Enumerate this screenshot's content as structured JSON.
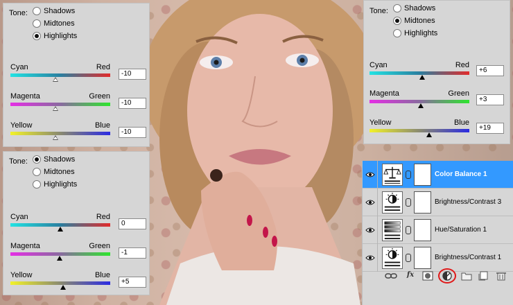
{
  "tone_options": [
    "Shadows",
    "Midtones",
    "Highlights"
  ],
  "panels": {
    "highlights": {
      "tone_label": "Tone:",
      "selected": "Highlights",
      "sliders": [
        {
          "left": "Cyan",
          "right": "Red",
          "value": "-10",
          "level": -10
        },
        {
          "left": "Magenta",
          "right": "Green",
          "value": "-10",
          "level": -10
        },
        {
          "left": "Yellow",
          "right": "Blue",
          "value": "-10",
          "level": -10
        }
      ]
    },
    "shadows": {
      "tone_label": "Tone:",
      "selected": "Shadows",
      "sliders": [
        {
          "left": "Cyan",
          "right": "Red",
          "value": "0",
          "level": 0
        },
        {
          "left": "Magenta",
          "right": "Green",
          "value": "-1",
          "level": -1
        },
        {
          "left": "Yellow",
          "right": "Blue",
          "value": "+5",
          "level": 5
        }
      ]
    },
    "midtones": {
      "tone_label": "Tone:",
      "selected": "Midtones",
      "sliders": [
        {
          "left": "Cyan",
          "right": "Red",
          "value": "+6",
          "level": 6
        },
        {
          "left": "Magenta",
          "right": "Green",
          "value": "+3",
          "level": 3
        },
        {
          "left": "Yellow",
          "right": "Blue",
          "value": "+19",
          "level": 19
        }
      ]
    }
  },
  "layers": [
    {
      "name": "Color Balance 1",
      "icon": "balance-scale-icon",
      "selected": true
    },
    {
      "name": "Brightness/Contrast 3",
      "icon": "sun-contrast-icon",
      "selected": false
    },
    {
      "name": "Hue/Saturation 1",
      "icon": "hue-saturation-icon",
      "selected": false
    },
    {
      "name": "Brightness/Contrast 1",
      "icon": "sun-contrast-icon",
      "selected": false
    }
  ],
  "layer_footer": {
    "fx_label": "fx",
    "tools": [
      "link-icon",
      "fx-icon",
      "mask-icon",
      "adjustment-layer-icon",
      "folder-icon",
      "new-layer-icon",
      "trash-icon"
    ]
  },
  "colors": {
    "selected_layer": "#3399ff",
    "panel_bg": "#d6d6d6",
    "highlight_ring": "#e01818"
  }
}
